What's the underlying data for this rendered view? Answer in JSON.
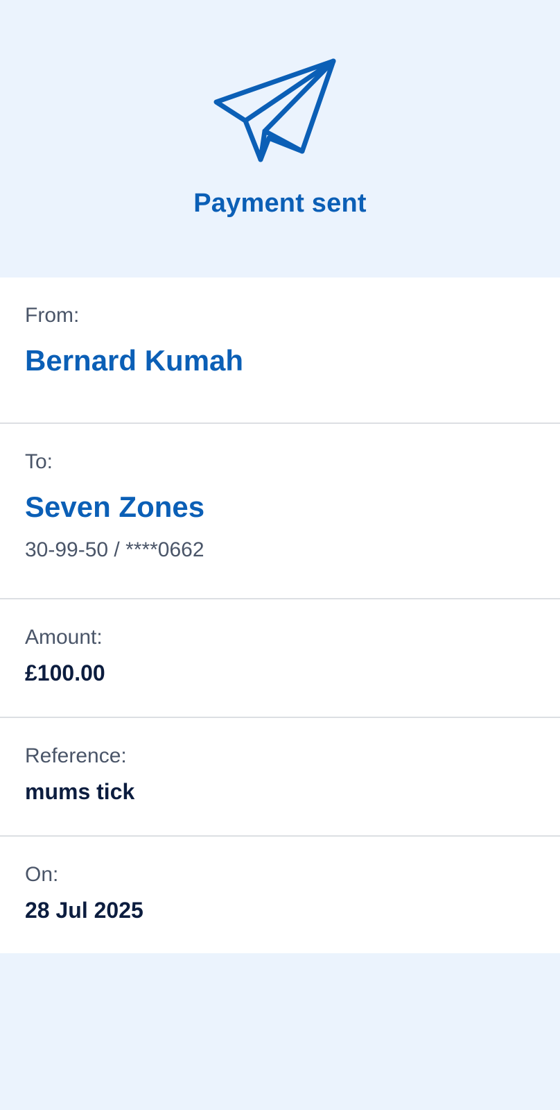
{
  "header": {
    "icon": "paper-plane-icon",
    "title": "Payment sent"
  },
  "details": {
    "from": {
      "label": "From:",
      "name": "Bernard Kumah"
    },
    "to": {
      "label": "To:",
      "name": "Seven Zones",
      "account": "30-99-50 / ****0662"
    },
    "amount": {
      "label": "Amount:",
      "value": "£100.00"
    },
    "reference": {
      "label": "Reference:",
      "value": "mums tick"
    },
    "on": {
      "label": "On:",
      "value": "28 Jul 2025"
    }
  },
  "colors": {
    "accent": "#0b5fb6",
    "background": "#ebf3fd",
    "text_primary": "#0c1d3f",
    "text_secondary": "#4a5568"
  }
}
